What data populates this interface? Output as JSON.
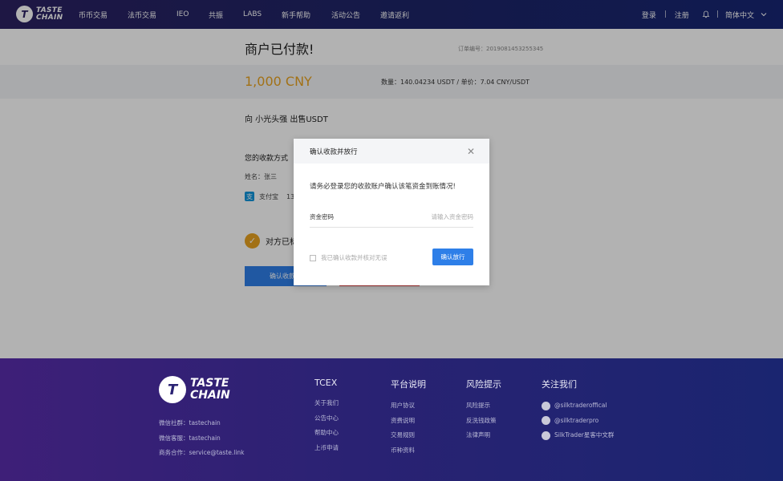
{
  "nav": {
    "logo_line1": "TASTE",
    "logo_line2": "CHAIN",
    "logo_glyph": "T",
    "links": [
      "币币交易",
      "法币交易",
      "IEO",
      "共振",
      "LABS",
      "新手帮助",
      "活动公告",
      "邀请返利"
    ],
    "login": "登录",
    "separator": "|",
    "register": "注册",
    "language": "简体中文"
  },
  "order": {
    "title": "商户已付款!",
    "order_no": "订单编号：2019081453255345",
    "amount": "1,000 CNY",
    "qty_price": "数量：140.04234 USDT   /   单价：7.04 CNY/USDT",
    "sell_to": "向 小光头强 出售USDT",
    "payment_method_label": "您的收款方式",
    "name": "姓名：张三",
    "alipay_icon": "支",
    "alipay_label": "支付宝",
    "alipay_account": "13",
    "check_glyph": "✓",
    "confirm_text": "对方已标",
    "release_button": "确认收款并"
  },
  "modal": {
    "title": "确认收款并放行",
    "close_glyph": "✕",
    "message": "请务必登录您的收款账户确认该笔资金到账情况!",
    "password_label": "资金密码",
    "password_placeholder": "请输入资金密码",
    "agree_text": "我已确认收款并核对无误",
    "confirm_button": "确认放行"
  },
  "footer": {
    "logo_line1": "TASTE",
    "logo_line2": "CHAIN",
    "logo_glyph": "T",
    "contacts": [
      "微信社群：tastechain",
      "微信客服：tastechain",
      "商务合作：service@taste.link"
    ],
    "columns": [
      {
        "heading": "TCEX",
        "items": [
          "关于我们",
          "公告中心",
          "帮助中心",
          "上币申请"
        ]
      },
      {
        "heading": "平台说明",
        "items": [
          "用户协议",
          "资费说明",
          "交易规则",
          "币种资料"
        ]
      },
      {
        "heading": "风险提示",
        "items": [
          "风险提示",
          "反洗钱政策",
          "法律声明"
        ]
      },
      {
        "heading": "关注我们",
        "items": [
          "@silktraderoffical",
          "@silktraderpro",
          "SilkTrader星客中文群"
        ]
      }
    ]
  }
}
